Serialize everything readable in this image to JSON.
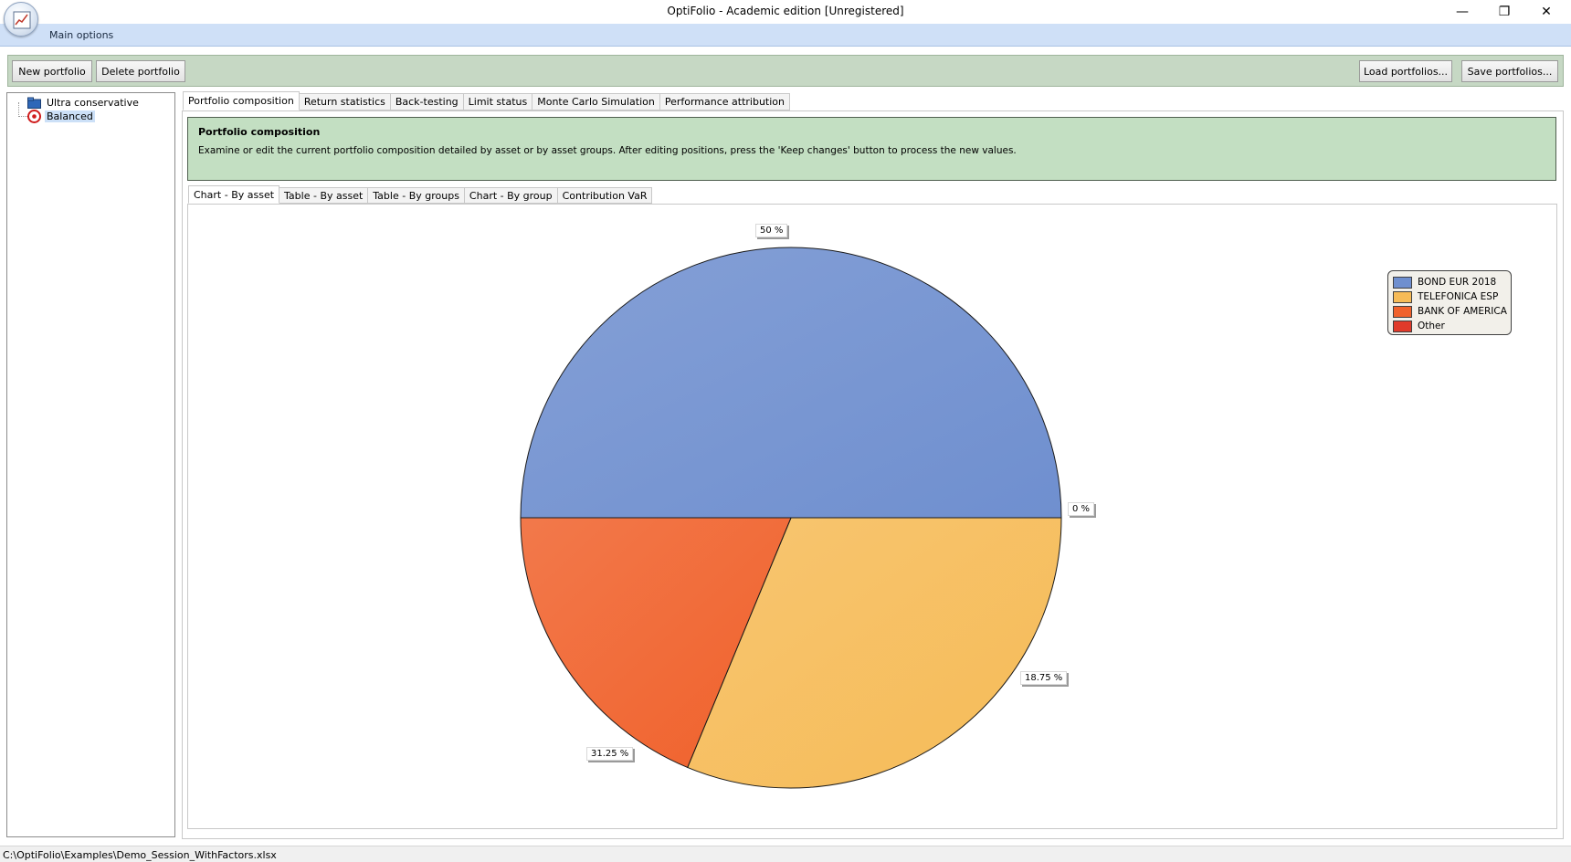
{
  "window": {
    "title": "OptiFolio - Academic edition [Unregistered]",
    "minimize": "—",
    "maximize": "❐",
    "close": "✕"
  },
  "ribbon": {
    "tab": "Main options"
  },
  "toolbar": {
    "new_portfolio": "New portfolio",
    "delete_portfolio": "Delete portfolio",
    "load_portfolios": "Load portfolios...",
    "save_portfolios": "Save portfolios..."
  },
  "tree": {
    "items": [
      {
        "label": "Ultra conservative",
        "icon": "folder-icon"
      },
      {
        "label": "Balanced",
        "icon": "target-icon",
        "selected": true
      }
    ]
  },
  "main_tabs": [
    {
      "label": "Portfolio composition",
      "active": true
    },
    {
      "label": "Return statistics"
    },
    {
      "label": "Back-testing"
    },
    {
      "label": "Limit status"
    },
    {
      "label": "Monte Carlo Simulation"
    },
    {
      "label": "Performance attribution"
    }
  ],
  "info": {
    "title": "Portfolio composition",
    "description": "Examine or edit the current portfolio composition detailed by asset or by asset groups. After editing positions, press the 'Keep changes' button to process the new values."
  },
  "sub_tabs": [
    {
      "label": "Chart - By asset",
      "active": true
    },
    {
      "label": "Table - By asset"
    },
    {
      "label": "Table - By groups"
    },
    {
      "label": "Chart - By group"
    },
    {
      "label": "Contribution VaR"
    }
  ],
  "chart_data": {
    "type": "pie",
    "categories": [
      "BOND EUR 2018",
      "TELEFONICA ESP",
      "BANK OF AMERICA",
      "Other"
    ],
    "values": [
      50,
      31.25,
      18.75,
      0
    ],
    "labels": [
      "50 %",
      "31.25 %",
      "18.75 %",
      "0 %"
    ],
    "colors": [
      "#6f8fcf",
      "#f6bb57",
      "#f0612b",
      "#e03a2a"
    ],
    "legend_position": "top-right"
  },
  "status": {
    "path": "C:\\OptiFolio\\Examples\\Demo_Session_WithFactors.xlsx"
  }
}
